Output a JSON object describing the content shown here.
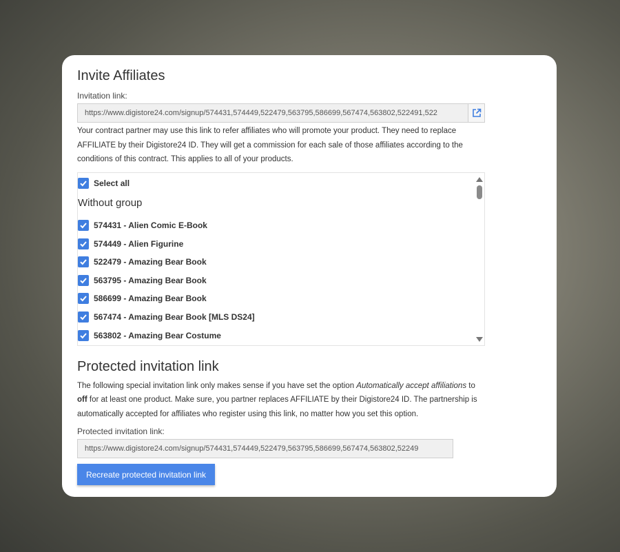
{
  "title": "Invite Affiliates",
  "invitation": {
    "label": "Invitation link:",
    "url": "https://www.digistore24.com/signup/574431,574449,522479,563795,586699,567474,563802,522491,522",
    "description": "Your contract partner may use this link to refer affiliates who will promote your product. They need to replace AFFILIATE by their Digistore24 ID. They will get a commission for each sale of those affiliates according to the conditions of this contract. This applies to all of your products."
  },
  "products": {
    "select_all": "Select all",
    "group_title": "Without group",
    "items": [
      {
        "label": "574431 - Alien Comic E-Book"
      },
      {
        "label": "574449 - Alien Figurine"
      },
      {
        "label": "522479 - Amazing Bear Book"
      },
      {
        "label": "563795 - Amazing Bear Book"
      },
      {
        "label": "586699 - Amazing Bear Book"
      },
      {
        "label": "567474 - Amazing Bear Book [MLS DS24]"
      },
      {
        "label": "563802 - Amazing Bear Costume"
      }
    ]
  },
  "protected": {
    "title": "Protected invitation link",
    "desc_part1": "The following special invitation link only makes sense if you have set the option ",
    "desc_italic": "Automatically accept affiliations",
    "desc_part2": " to ",
    "desc_bold": "off",
    "desc_part3": " for at least one product. Make sure, you partner replaces AFFILIATE by their Digistore24 ID. The partnership is automatically accepted for affiliates who register using this link, no matter how you set this option.",
    "label": "Protected invitation link:",
    "url": "https://www.digistore24.com/signup/574431,574449,522479,563795,586699,567474,563802,52249",
    "button": "Recreate protected invitation link"
  },
  "colors": {
    "accent": "#4a86e8",
    "checkbox": "#3f7ee0"
  },
  "icons": {
    "open_link": "external-link-icon",
    "check": "checkmark-icon"
  }
}
